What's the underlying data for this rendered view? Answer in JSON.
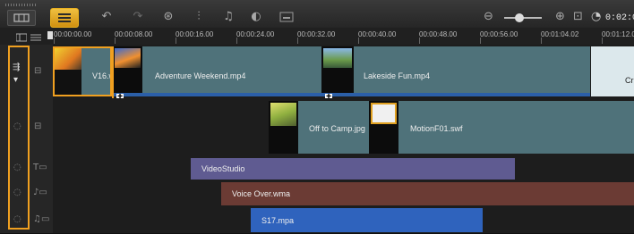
{
  "colors": {
    "accent": "#f0a020",
    "video_clip": "#4f727a",
    "title_clip": "#5f5b91",
    "voice_clip": "#6b3b34",
    "music_clip": "#2f63bd"
  },
  "toolbar": {
    "icons": [
      "storyboard-view-icon",
      "timeline-view-icon",
      "undo-icon",
      "redo-icon",
      "record-capture-icon",
      "sound-mixer-icon",
      "auto-music-icon",
      "motion-track-icon",
      "subtitle-icon"
    ],
    "zoom_out_icon": "zoom-out-icon",
    "zoom_in_icon": "zoom-in-icon",
    "fit_icon": "fit-project-icon",
    "clock_icon": "duration-icon",
    "timecode": "0:02:0"
  },
  "ruler": {
    "ticks": [
      "00:00:00.00",
      "00:00:08.00",
      "00:00:16.00",
      "00:00:24.00",
      "00:00:32.00",
      "00:00:40.00",
      "00:00:48.00",
      "00:00:56.00",
      "00:01:04.02",
      "00:01:12.0"
    ]
  },
  "tracks": {
    "video": {
      "clips": [
        {
          "label": "V16.w"
        },
        {
          "label": "Adventure Weekend.mp4"
        },
        {
          "label": "Lakeside Fun.mp4"
        },
        {
          "label": "Cr"
        }
      ]
    },
    "overlay": {
      "clips": [
        {
          "label": "Off to Camp.jpg"
        },
        {
          "label": "MotionF01.swf"
        }
      ]
    },
    "title": {
      "clip": {
        "label": "VideoStudio"
      }
    },
    "voice": {
      "clip": {
        "label": "Voice Over.wma"
      }
    },
    "music": {
      "clip": {
        "label": "S17.mpa"
      }
    }
  }
}
